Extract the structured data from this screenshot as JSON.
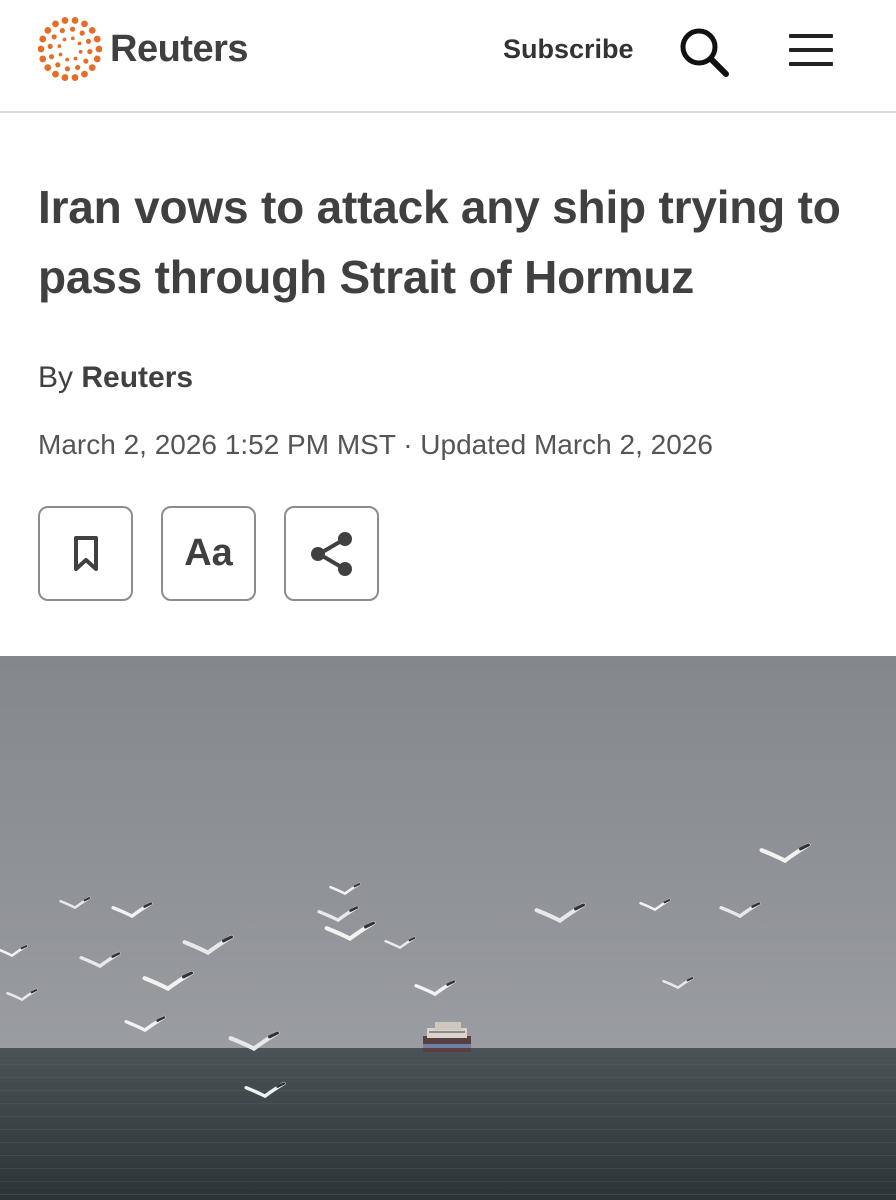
{
  "header": {
    "brand": "Reuters",
    "subscribe_label": "Subscribe",
    "search_icon": "search-icon",
    "menu_icon": "hamburger-menu-icon",
    "brand_color": "#e26e2a"
  },
  "article": {
    "headline": "Iran vows to attack any ship trying to pass through Strait of Hormuz",
    "byline_prefix": "By",
    "author": "Reuters",
    "dateline": "March 2, 2026 1:52 PM MST · Updated March 2, 2026",
    "tools": [
      {
        "name": "bookmark",
        "icon": "bookmark-icon"
      },
      {
        "name": "text-size",
        "label": "Aa"
      },
      {
        "name": "share",
        "icon": "share-icon"
      }
    ]
  },
  "photo": {
    "sky_color": "#8f9194",
    "sea_color": "#3a4246"
  }
}
